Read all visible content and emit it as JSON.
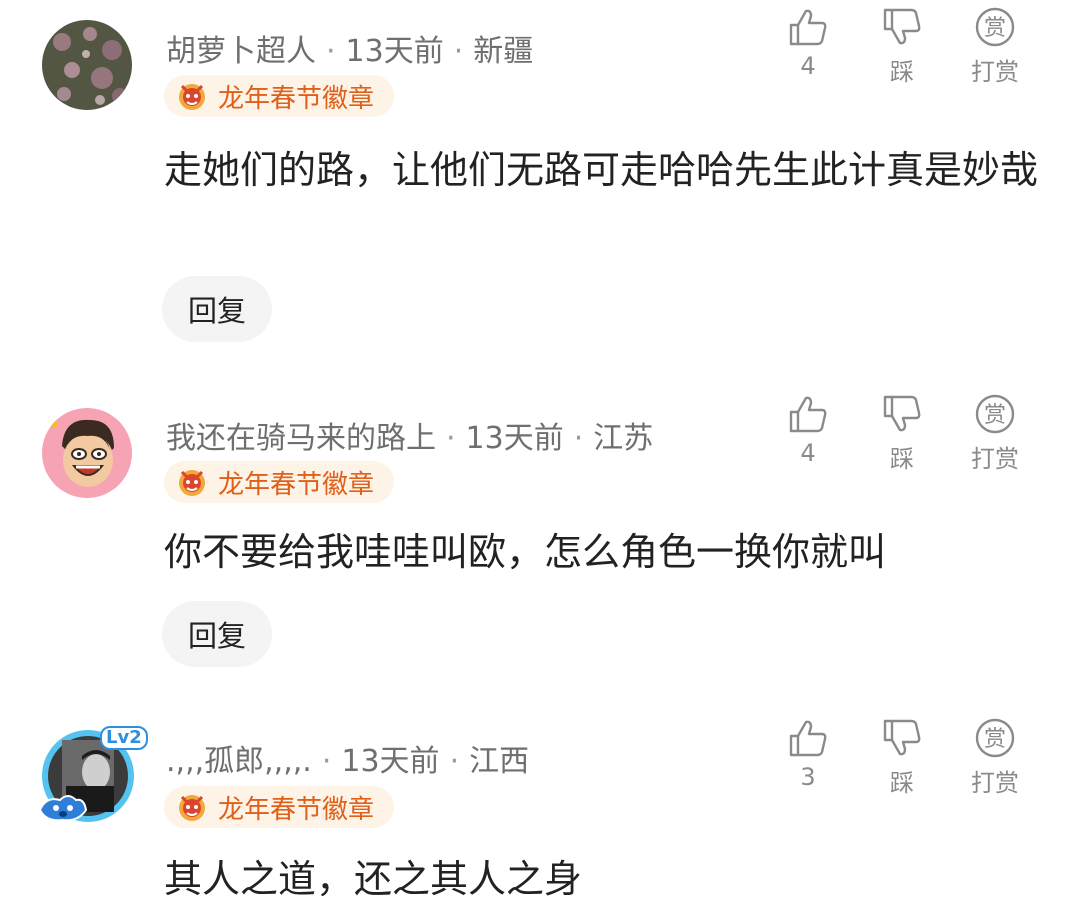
{
  "comments": [
    {
      "username": "胡萝卜超人",
      "time": "13天前",
      "location": "新疆",
      "badge": "龙年春节徽章",
      "content": "走她们的路，让他们无路可走哈哈先生此计真是妙哉",
      "reply_label": "回复",
      "likes": "4",
      "dislike_label": "踩",
      "reward_label": "打赏",
      "reward_icon_text": "赏"
    },
    {
      "username": "我还在骑马来的路上",
      "time": "13天前",
      "location": "江苏",
      "badge": "龙年春节徽章",
      "content": "你不要给我哇哇叫欧，怎么角色一换你就叫",
      "reply_label": "回复",
      "likes": "4",
      "dislike_label": "踩",
      "reward_label": "打赏",
      "reward_icon_text": "赏"
    },
    {
      "username": ".,,,孤郎,,,,.",
      "time": "13天前",
      "location": "江西",
      "badge": "龙年春节徽章",
      "content": "其人之道，还之其人之身",
      "level_badge": "Lv2",
      "likes": "3",
      "dislike_label": "踩",
      "reward_label": "打赏",
      "reward_icon_text": "赏"
    }
  ]
}
